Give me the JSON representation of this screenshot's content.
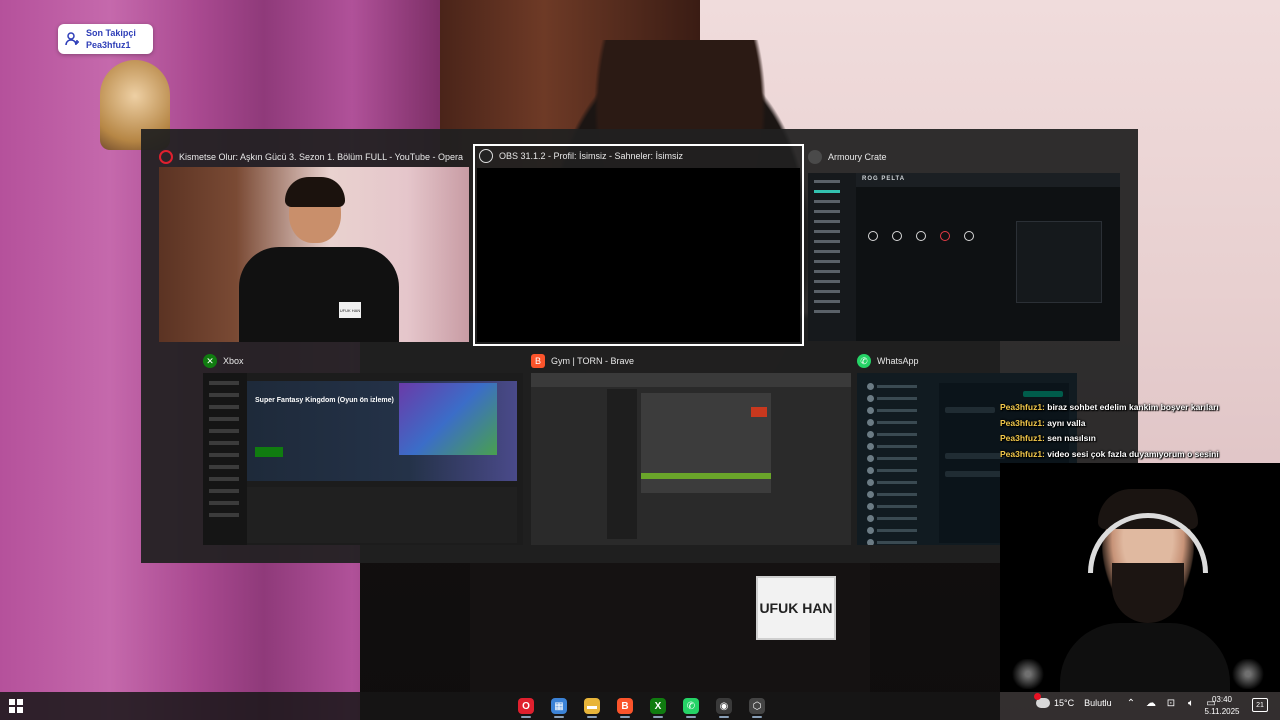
{
  "background": {
    "name_tag": "UFUK HAN"
  },
  "follower_widget": {
    "label": "Son Takipçi",
    "user": "Pea3hfuz1"
  },
  "switcher": {
    "windows": [
      {
        "title": "Kismetse Olur: Aşkın Gücü 3. Sezon 1. Bölüm FULL - YouTube - Opera",
        "icon": "opera-icon",
        "color": "#e0202e"
      },
      {
        "title": "OBS 31.1.2 - Profil: İsimsiz - Sahneler: İsimsiz",
        "icon": "obs-icon",
        "color": "#3a3a3a",
        "selected": true
      },
      {
        "title": "Armoury Crate",
        "icon": "armoury-crate-icon",
        "color": "#555"
      },
      {
        "title": "Xbox",
        "icon": "xbox-icon",
        "color": "#107c10"
      },
      {
        "title": "Gym | TORN - Brave",
        "icon": "brave-icon",
        "color": "#fb542b"
      },
      {
        "title": "WhatsApp",
        "icon": "whatsapp-icon",
        "color": "#25d366"
      }
    ],
    "armoury_brand": "ROG PELTA",
    "xbox_game": "Super Fantasy Kingdom (Oyun ön izleme)",
    "youtube_tag": "UFUK HAN"
  },
  "chat": [
    {
      "user": "Pea3hfuz1:",
      "message": "biraz sohbet edelim kankim boşver karıları"
    },
    {
      "user": "Pea3hfuz1:",
      "message": "aynı valla"
    },
    {
      "user": "Pea3hfuz1:",
      "message": "sen nasılsın"
    },
    {
      "user": "Pea3hfuz1:",
      "message": "video sesi çok fazla duyamıyorum o sesini"
    }
  ],
  "taskbar": {
    "apps": [
      {
        "name": "opera-icon",
        "color": "#e0202e",
        "glyph": "O"
      },
      {
        "name": "store-icon",
        "color": "#3b82d6",
        "glyph": "▦"
      },
      {
        "name": "file-explorer-icon",
        "color": "#e8b53a",
        "glyph": "▬"
      },
      {
        "name": "brave-icon",
        "color": "#fb542b",
        "glyph": "B"
      },
      {
        "name": "xbox-icon",
        "color": "#107c10",
        "glyph": "X"
      },
      {
        "name": "whatsapp-icon",
        "color": "#25d366",
        "glyph": "✆"
      },
      {
        "name": "obs-icon",
        "color": "#3a3a3a",
        "glyph": "◉"
      },
      {
        "name": "armoury-crate-icon",
        "color": "#444",
        "glyph": "⬡"
      }
    ],
    "weather_temp": "15°C",
    "weather_desc": "Bulutlu",
    "time": "03:40",
    "date": "5.11.2025",
    "notifications": "21"
  }
}
